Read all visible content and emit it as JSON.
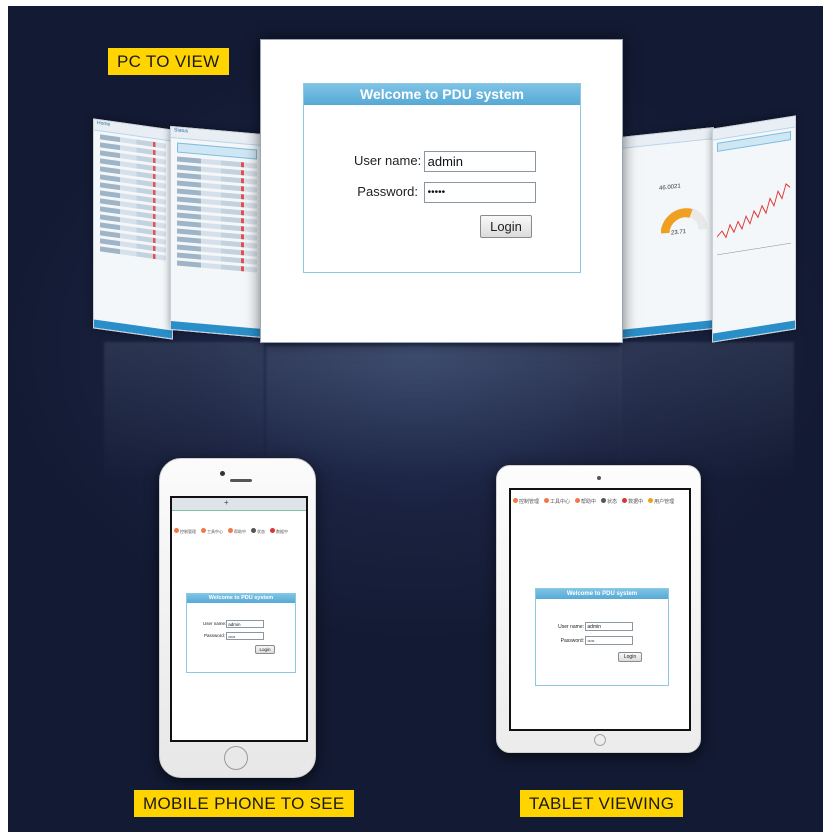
{
  "labels": {
    "pc": "PC TO VIEW",
    "mobile": "MOBILE PHONE TO SEE",
    "tablet": "TABLET VIEWING"
  },
  "login": {
    "title": "Welcome to PDU system",
    "username_label": "User name:",
    "username_value": "admin",
    "password_label": "Password:",
    "password_value": "•••••",
    "button": "Login"
  },
  "side_screens": {
    "left_title_1": "Home",
    "left_title_2": "Status",
    "gauge_value": "46.0021",
    "gauge_reading": "23.71"
  },
  "browser_nav": {
    "items": [
      "控制管理",
      "工具中心",
      "帮助中",
      "状态",
      "数据中",
      "用户管理"
    ]
  },
  "phone_browser": {
    "tab_plus": "+"
  },
  "colors": {
    "background": "#1a2240",
    "badge": "#ffd400",
    "login_header": "#5aabd8",
    "login_border": "#8cc7e3"
  }
}
